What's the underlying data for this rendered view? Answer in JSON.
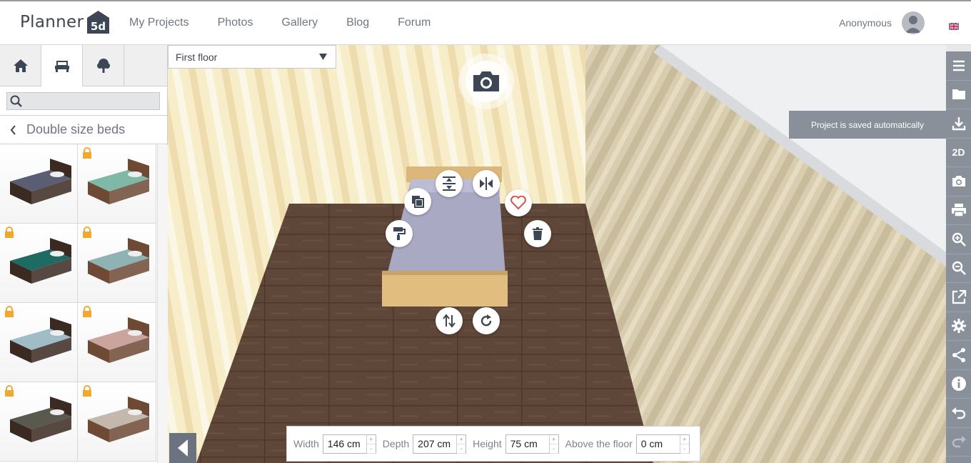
{
  "header": {
    "logo_text": "Planner",
    "logo_mark": "5d",
    "nav": [
      {
        "label": "My Projects"
      },
      {
        "label": "Photos"
      },
      {
        "label": "Gallery"
      },
      {
        "label": "Blog"
      },
      {
        "label": "Forum"
      }
    ],
    "user_name": "Anonymous",
    "language_icon": "uk-flag-icon"
  },
  "sidebar": {
    "tabs": [
      {
        "icon": "house-icon",
        "active": false
      },
      {
        "icon": "furniture-icon",
        "active": true
      },
      {
        "icon": "tree-icon",
        "active": false
      }
    ],
    "search": {
      "value": "",
      "placeholder": ""
    },
    "category": "Double size beds",
    "items": [
      {
        "color": "#5b5d73",
        "locked": false
      },
      {
        "color": "#7fb8a6",
        "locked": true
      },
      {
        "color": "#1e6b63",
        "locked": true
      },
      {
        "color": "#8fb3b5",
        "locked": true
      },
      {
        "color": "#9fbcc7",
        "locked": true
      },
      {
        "color": "#c9a59e",
        "locked": true
      },
      {
        "color": "#5a5950",
        "locked": true
      },
      {
        "color": "#c4b8ad",
        "locked": true
      }
    ]
  },
  "canvas": {
    "floor": "First floor",
    "toast": "Project is saved automatically",
    "controls": [
      "copy-icon",
      "align-vertical-icon",
      "mirror-icon",
      "favorite-icon",
      "paint-icon",
      "delete-icon",
      "flip-icon",
      "rotate-icon"
    ]
  },
  "dimensions": {
    "width_label": "Width",
    "width_value": "146 cm",
    "depth_label": "Depth",
    "depth_value": "207 cm",
    "height_label": "Height",
    "height_value": "75 cm",
    "above_label": "Above the floor",
    "above_value": "0 cm"
  },
  "right_toolbar": [
    {
      "icon": "menu-icon",
      "label": ""
    },
    {
      "icon": "folder-icon",
      "label": ""
    },
    {
      "icon": "download-icon",
      "label": ""
    },
    {
      "icon": "view-2d-icon",
      "label": "2D"
    },
    {
      "icon": "camera-icon",
      "label": ""
    },
    {
      "icon": "print-icon",
      "label": ""
    },
    {
      "icon": "zoom-in-icon",
      "label": ""
    },
    {
      "icon": "zoom-out-icon",
      "label": ""
    },
    {
      "icon": "external-link-icon",
      "label": ""
    },
    {
      "icon": "settings-icon",
      "label": ""
    },
    {
      "icon": "share-icon",
      "label": ""
    },
    {
      "icon": "info-icon",
      "label": ""
    },
    {
      "icon": "undo-icon",
      "label": ""
    },
    {
      "icon": "redo-icon",
      "label": ""
    }
  ],
  "colors": {
    "accent_dark": "#3d4654",
    "toolbar": "#8a909a",
    "floor": "#5e4638",
    "wall_light": "#f6eccb",
    "lock": "#f0a830"
  }
}
